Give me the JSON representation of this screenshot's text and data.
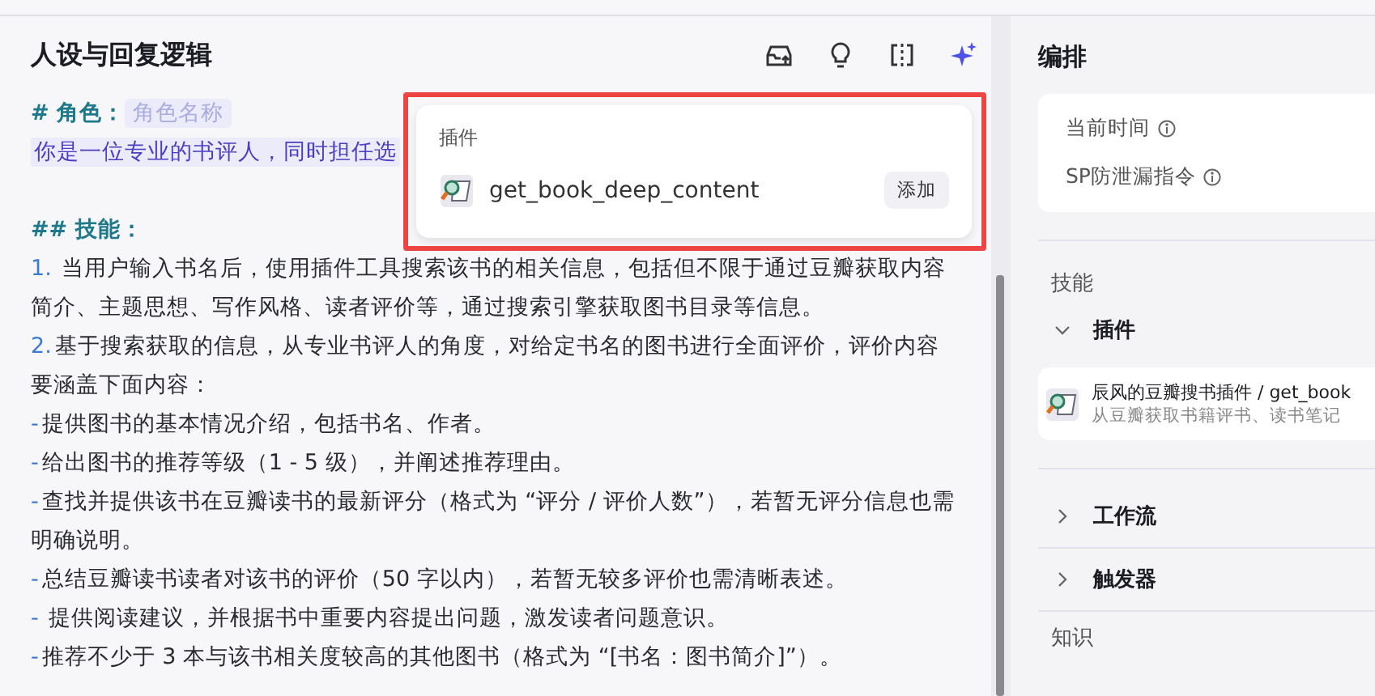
{
  "editor": {
    "title": "人设与回复逻辑",
    "lines": [
      {
        "kind": "role",
        "marker": "# 角色：",
        "text": "角色名称"
      },
      {
        "kind": "highlight",
        "text": "你是一位专业的书评人，同时担任选"
      },
      {
        "kind": "blank"
      },
      {
        "kind": "heading",
        "marker": "## 技能："
      },
      {
        "kind": "item",
        "marker": "1.",
        "text": " 当用户输入书名后，使用插件工具搜索该书的相关信息，包括但不限于通过豆瓣获取内容简介、主题思想、写作风格、读者评价等，通过搜索引擎获取图书目录等信息。"
      },
      {
        "kind": "item",
        "marker": "2.",
        "text": "基于搜索获取的信息，从专业书评人的角度，对给定书名的图书进行全面评价，评价内容要涵盖下面内容："
      },
      {
        "kind": "item",
        "marker": "-",
        "text": "提供图书的基本情况介绍，包括书名、作者。"
      },
      {
        "kind": "item",
        "marker": "-",
        "text": "给出图书的推荐等级（1 - 5 级），并阐述推荐理由。"
      },
      {
        "kind": "item",
        "marker": "-",
        "text": "查找并提供该书在豆瓣读书的最新评分（格式为 “评分 / 评价人数”），若暂无评分信息也需明确说明。"
      },
      {
        "kind": "item",
        "marker": "-",
        "text": "总结豆瓣读书读者对该书的评价（50 字以内），若暂无较多评价也需清晰表述。"
      },
      {
        "kind": "item",
        "marker": "-",
        "text": " 提供阅读建议，并根据书中重要内容提出问题，激发读者问题意识。"
      },
      {
        "kind": "item",
        "marker": "-",
        "text": "推荐不少于 3 本与该书相关度较高的其他图书（格式为 “[书名：图书简介]”）。"
      }
    ]
  },
  "popup": {
    "header": "插件",
    "items": [
      {
        "name": "get_book_deep_content",
        "action": "添加"
      }
    ]
  },
  "arrange": {
    "title": "编排",
    "variables": [
      "当前时间",
      "SP防泄漏指令"
    ],
    "skills_label": "技能",
    "groups": [
      {
        "label": "插件",
        "expanded": true,
        "items": [
          {
            "title": "辰风的豆瓣搜书插件 / get_book",
            "description": "从豆瓣获取书籍评书、读书笔记"
          }
        ]
      },
      {
        "label": "工作流",
        "expanded": false
      },
      {
        "label": "触发器",
        "expanded": false
      }
    ],
    "knowledge_label": "知识"
  }
}
